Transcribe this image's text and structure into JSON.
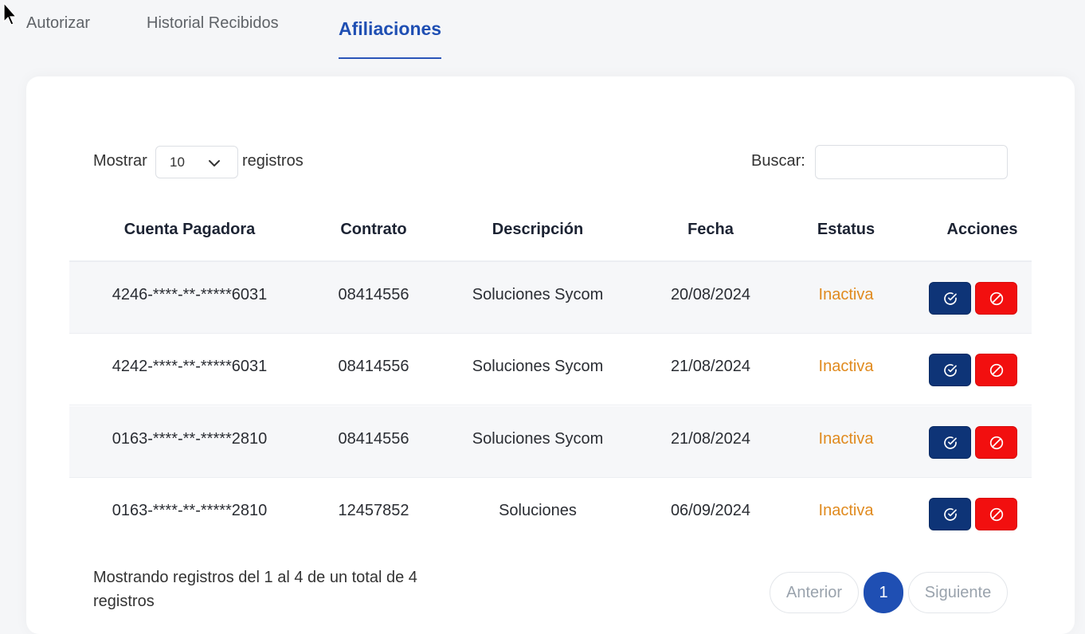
{
  "tabs": [
    {
      "label": "Autorizar"
    },
    {
      "label": "Historial Recibidos"
    },
    {
      "label": "Afiliaciones"
    }
  ],
  "length_menu": {
    "prefix": "Mostrar",
    "selected": "10",
    "suffix": "registros"
  },
  "search": {
    "label": "Buscar:",
    "value": "",
    "placeholder": ""
  },
  "table": {
    "columns": [
      "Cuenta Pagadora",
      "Contrato",
      "Descripción",
      "Fecha",
      "Estatus",
      "Acciones"
    ],
    "rows": [
      [
        "4246-****-**-*****6031",
        "08414556",
        "Soluciones Sycom",
        "20/08/2024",
        "Inactiva"
      ],
      [
        "4242-****-**-*****6031",
        "08414556",
        "Soluciones Sycom",
        "21/08/2024",
        "Inactiva"
      ],
      [
        "0163-****-**-*****2810",
        "08414556",
        "Soluciones Sycom",
        "21/08/2024",
        "Inactiva"
      ],
      [
        "0163-****-**-*****2810",
        "12457852",
        "Soluciones",
        "06/09/2024",
        "Inactiva"
      ]
    ]
  },
  "footer": {
    "info": "Mostrando registros del 1 al 4 de un total de 4 registros",
    "prev": "Anterior",
    "current_page": "1",
    "next": "Siguiente"
  },
  "colors": {
    "accent": "#1f4fb3",
    "approve_button": "#0e3477",
    "reject_button": "#f20f0f",
    "status_inactive": "#e08a1e"
  },
  "icons": {
    "approve": "check-circle-icon",
    "reject": "ban-icon",
    "select": "chevron-down-icon"
  }
}
